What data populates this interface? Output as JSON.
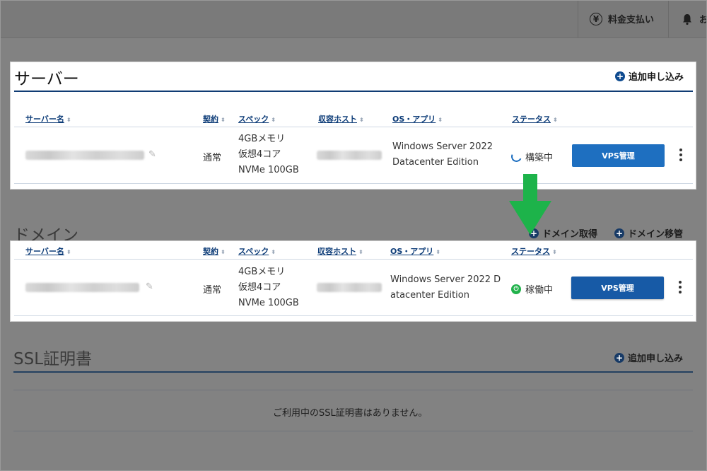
{
  "header": {
    "billing_label": "料金支払い",
    "notice_label": "お"
  },
  "server_section": {
    "title": "サーバー",
    "add_label": "追加申し込み"
  },
  "domain_section": {
    "title": "ドメイン",
    "acquire_label": "ドメイン取得",
    "transfer_label": "ドメイン移管"
  },
  "ssl_section": {
    "title": "SSL証明書",
    "add_label": "追加申し込み",
    "empty_message": "ご利用中のSSL証明書はありません。"
  },
  "table_headers": {
    "server_name": "サーバー名",
    "contract": "契約",
    "spec": "スペック",
    "host": "収容ホスト",
    "os_app": "OS・アプリ",
    "status": "ステータス"
  },
  "rows": [
    {
      "contract": "通常",
      "spec_lines": [
        "4GBメモリ",
        "仮想4コア",
        "NVMe 100GB"
      ],
      "os_lines": [
        "Windows Server 2022",
        "Datacenter Edition"
      ],
      "status": "構築中",
      "status_icon": "spinner-icon",
      "button_label": "VPS管理"
    },
    {
      "contract": "通常",
      "spec_lines": [
        "4GBメモリ",
        "仮想4コア",
        "NVMe 100GB"
      ],
      "os_lines": [
        "Windows Server 2022 D",
        "atacenter Edition"
      ],
      "status": "稼働中",
      "status_icon": "power-icon",
      "button_label": "VPS管理"
    }
  ],
  "colors": {
    "accent": "#1e6fc0",
    "header_link": "#0d3c78",
    "arrow": "#1db34a",
    "running": "#21b24b"
  }
}
